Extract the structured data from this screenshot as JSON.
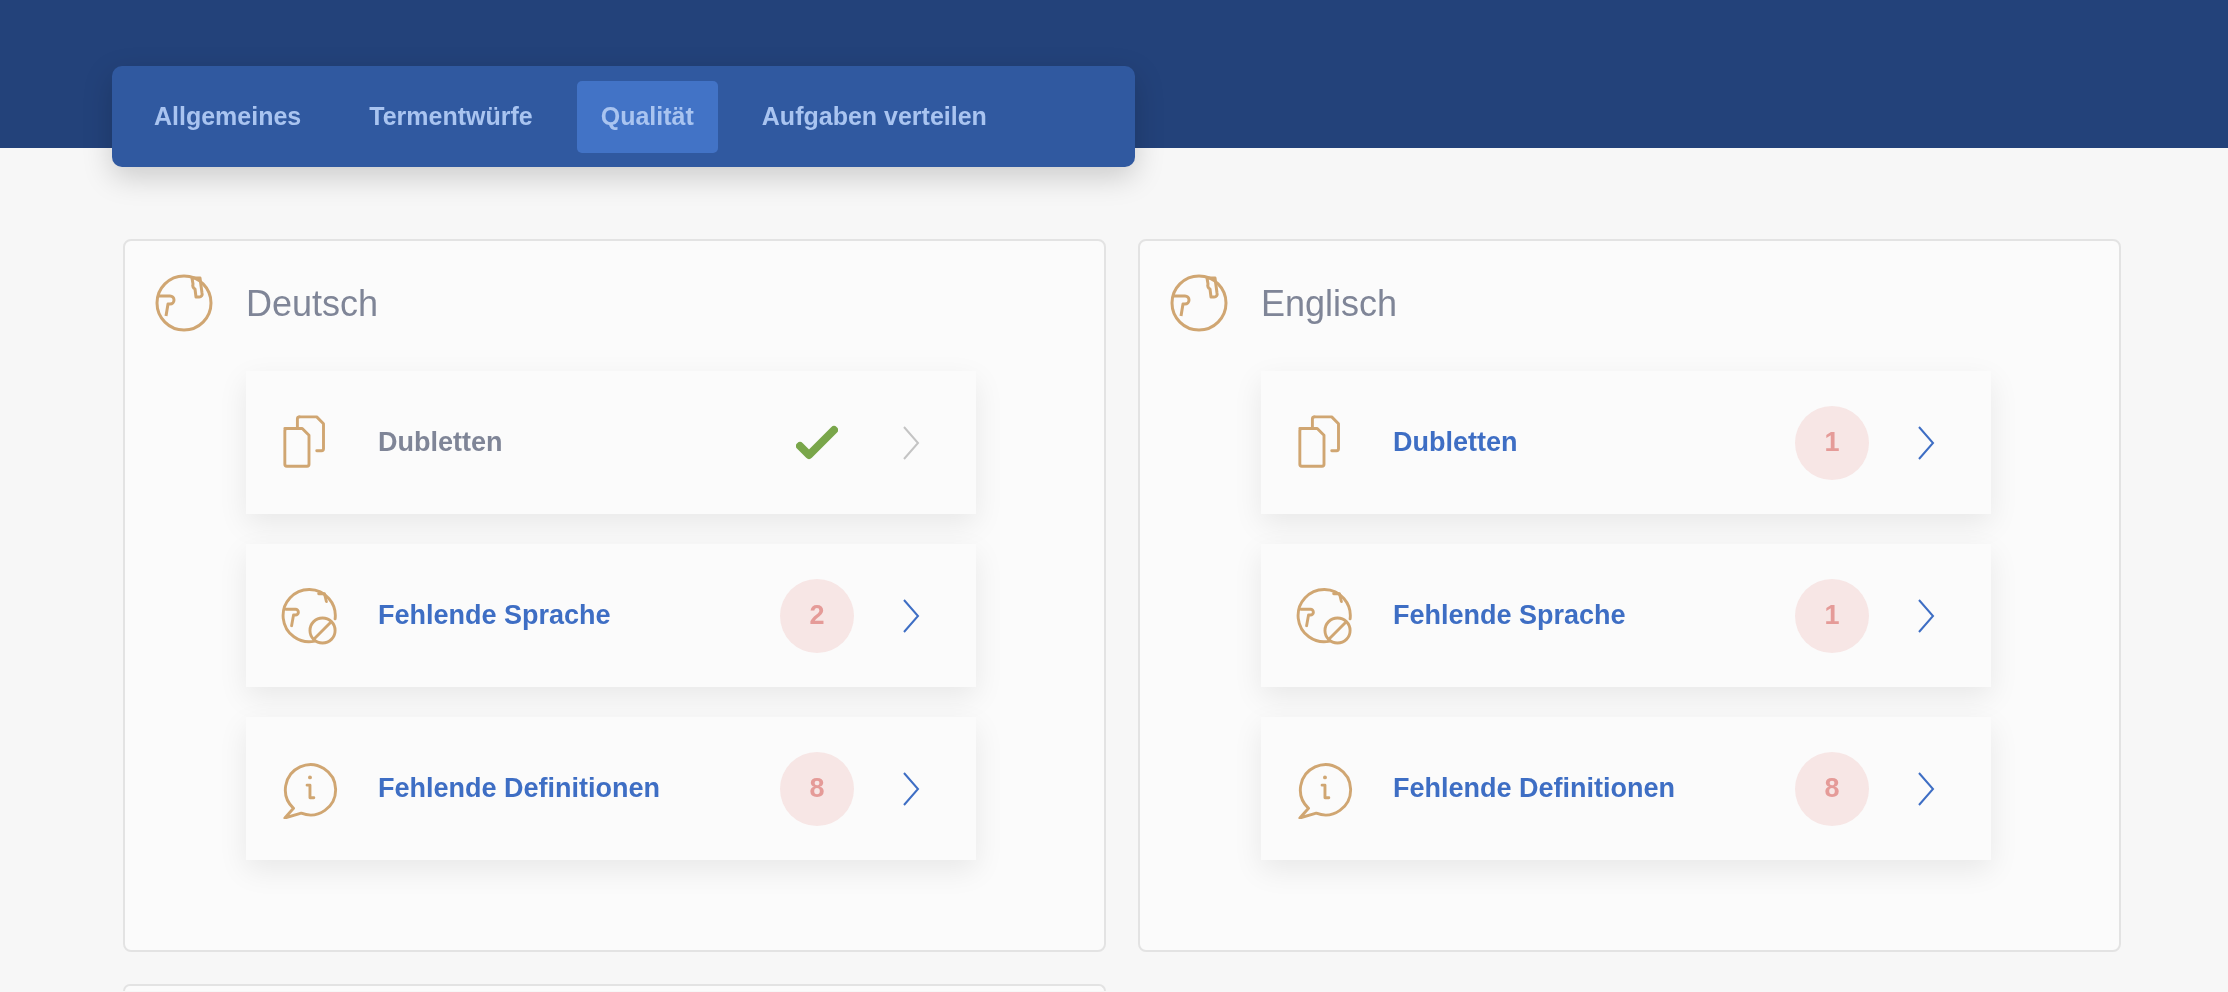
{
  "tabs": [
    {
      "label": "Allgemeines",
      "selected": false
    },
    {
      "label": "Termentwürfe",
      "selected": false
    },
    {
      "label": "Qualität",
      "selected": true
    },
    {
      "label": "Aufgaben verteilen",
      "selected": false
    }
  ],
  "languages": [
    {
      "title": "Deutsch",
      "checks": [
        {
          "label": "Dubletten",
          "kind": "ok"
        },
        {
          "label": "Fehlende Sprache",
          "kind": "count",
          "count": "2"
        },
        {
          "label": "Fehlende Definitionen",
          "kind": "count",
          "count": "8"
        }
      ]
    },
    {
      "title": "Englisch",
      "checks": [
        {
          "label": "Dubletten",
          "kind": "count",
          "count": "1"
        },
        {
          "label": "Fehlende Sprache",
          "kind": "count",
          "count": "1"
        },
        {
          "label": "Fehlende Definitionen",
          "kind": "count",
          "count": "8"
        }
      ]
    }
  ]
}
